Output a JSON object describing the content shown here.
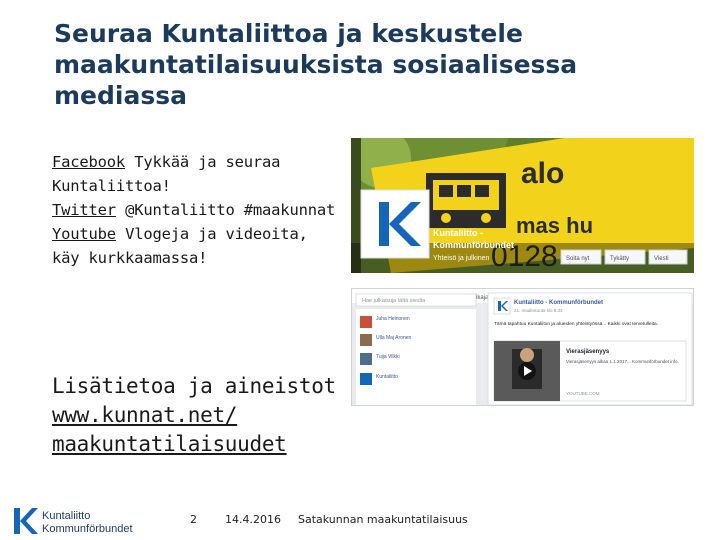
{
  "slide": {
    "title_lines": [
      "Seuraa Kuntaliittoa ja keskustele",
      "maakuntatilaisuuksista sosiaalisessa",
      "mediassa"
    ],
    "links": {
      "facebook_link": "Facebook",
      "facebook_text": " Tykkää ja seuraa Kuntaliittoa!",
      "twitter_link": "Twitter",
      "twitter_text": " @Kuntaliitto #maakunnat",
      "youtube_link": "Youtube",
      "youtube_text": " Vlogeja ja videoita, käy kurkkaamassa!"
    },
    "more_info": {
      "heading": "Lisätietoa ja aineistot",
      "url_line1": "www.kunnat.net/",
      "url_line2": "maakuntatilaisuudet"
    }
  },
  "footer": {
    "logo_line1": "Kuntaliitto",
    "logo_line2": "Kommunförbundet",
    "page_number": "2",
    "date": "14.4.2016",
    "event": "Satakunnan maakuntatilaisuus"
  },
  "facebook_cover": {
    "sign_text_1": "alo",
    "sign_text_2": "mas hu",
    "sign_number": "0128",
    "page_name_line1": "Kuntaliitto -",
    "page_name_line2": "Kommunförbundet",
    "subtitle": "Yhteisö ja julkinen",
    "buttons": [
      "Soita nyt",
      "Tykätty",
      "Viesti"
    ],
    "tab": "Aikajana"
  },
  "facebook_feed": {
    "search_placeholder": "Hae julkaisuja tältä sivulta",
    "post_author": "Kuntaliitto - Kommunförbundet",
    "post_meta": "21. maaliskuuta klo 9.33",
    "post_text": "Tämä tapahtuu Kuntaliiton ja alueiden yhteistyössä... Kaikki ovat tervetulleita.",
    "link_title": "Vierasjäsenyys",
    "link_desc": "Vierasjäsenyys alkaa 1.1.2017... Kommunförbundet info.",
    "link_source": "YOUTUBE.COM",
    "side_items": [
      "Juha Heinonen",
      "Ulla Maj Aronen",
      "Tuija Vilkki",
      "Kuntaliitto"
    ]
  },
  "colors": {
    "title": "#1b3a5c",
    "brand_blue": "#1565b8",
    "fb_blue": "#3b5998"
  }
}
